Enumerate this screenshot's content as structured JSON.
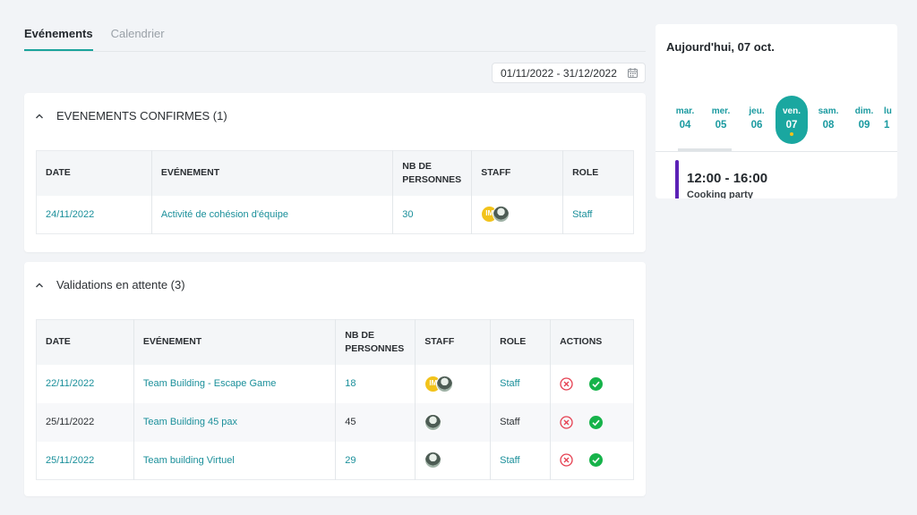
{
  "tabs": [
    {
      "label": "Evénements",
      "active": true
    },
    {
      "label": "Calendrier",
      "active": false
    }
  ],
  "date_range": {
    "value": "01/11/2022 - 31/12/2022",
    "icon": "calendar-icon"
  },
  "confirmed": {
    "title": "EVENEMENTS CONFIRMES (1)",
    "headers": {
      "date": "DATE",
      "event": "EVÉNEMENT",
      "nb_line1": "NB DE",
      "nb_line2": "PERSONNES",
      "staff": "STAFF",
      "role": "ROLE"
    },
    "rows": [
      {
        "date": "24/11/2022",
        "event": "Activité de cohésion d'équipe",
        "nb": "30",
        "staff_initials": "IM",
        "role": "Staff"
      }
    ]
  },
  "pending": {
    "title": "Validations en attente (3)",
    "headers": {
      "date": "DATE",
      "event": "EVÉNEMENT",
      "nb_line1": "NB DE",
      "nb_line2": "PERSONNES",
      "staff": "STAFF",
      "role": "ROLE",
      "actions": "ACTIONS"
    },
    "rows": [
      {
        "date": "22/11/2022",
        "event": "Team Building - Escape Game",
        "nb": "18",
        "staff_initials": "IM",
        "role": "Staff"
      },
      {
        "date": "25/11/2022",
        "event": "Team Building 45 pax",
        "nb": "45",
        "role": "Staff"
      },
      {
        "date": "25/11/2022",
        "event": "Team building Virtuel",
        "nb": "29",
        "role": "Staff"
      }
    ]
  },
  "agenda": {
    "today_label": "Aujourd'hui, 07 oct.",
    "days": [
      {
        "name": "",
        "num": ""
      },
      {
        "name": "mar.",
        "num": "04"
      },
      {
        "name": "mer.",
        "num": "05"
      },
      {
        "name": "jeu.",
        "num": "06"
      },
      {
        "name": "ven.",
        "num": "07"
      },
      {
        "name": "sam.",
        "num": "08"
      },
      {
        "name": "dim.",
        "num": "09"
      },
      {
        "name": "lu",
        "num": "1"
      }
    ],
    "event": {
      "time": "12:00 - 16:00",
      "title": "Cooking party",
      "color": "#5b21b6"
    }
  },
  "colors": {
    "accent": "#1aa39b",
    "link": "#1a8f9a",
    "reject": "#e53e4f",
    "accept": "#16b34a"
  }
}
